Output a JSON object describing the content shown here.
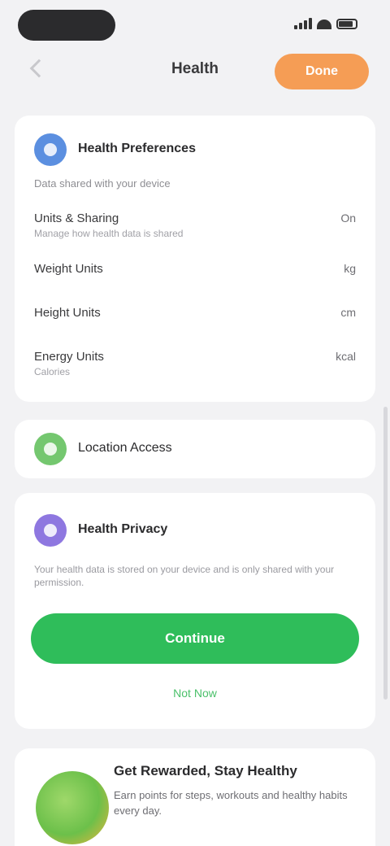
{
  "status_bar": {
    "time": ""
  },
  "nav": {
    "title": "Health",
    "action_label": "Done"
  },
  "summary_card": {
    "icon": "heart-icon",
    "title": "Health Preferences",
    "subtitle": "Data shared with your device",
    "rows": [
      {
        "label": "Units & Sharing",
        "sublabel": "Manage how health data is shared",
        "value": "On"
      },
      {
        "label": "Weight Units",
        "sublabel": "",
        "value": "kg"
      },
      {
        "label": "Height Units",
        "sublabel": "",
        "value": "cm"
      },
      {
        "label": "Energy Units",
        "sublabel": "Calories",
        "value": "kcal"
      }
    ]
  },
  "location_card": {
    "icon": "location-icon",
    "title": "Location Access"
  },
  "privacy_card": {
    "icon": "shield-icon",
    "title": "Health Privacy",
    "description": "Your health data is stored on your device and is only shared with your permission.",
    "primary_label": "Continue",
    "secondary_label": "Not Now"
  },
  "promo_card": {
    "image": "app-logo-image",
    "title": "Get Rewarded, Stay Healthy",
    "description": "Earn points for steps, workouts and healthy habits every day."
  },
  "colors": {
    "accent": "#2fbd5a",
    "orange": "#f59d55",
    "blue": "#5b8fe0",
    "purple": "#8e77e0"
  }
}
